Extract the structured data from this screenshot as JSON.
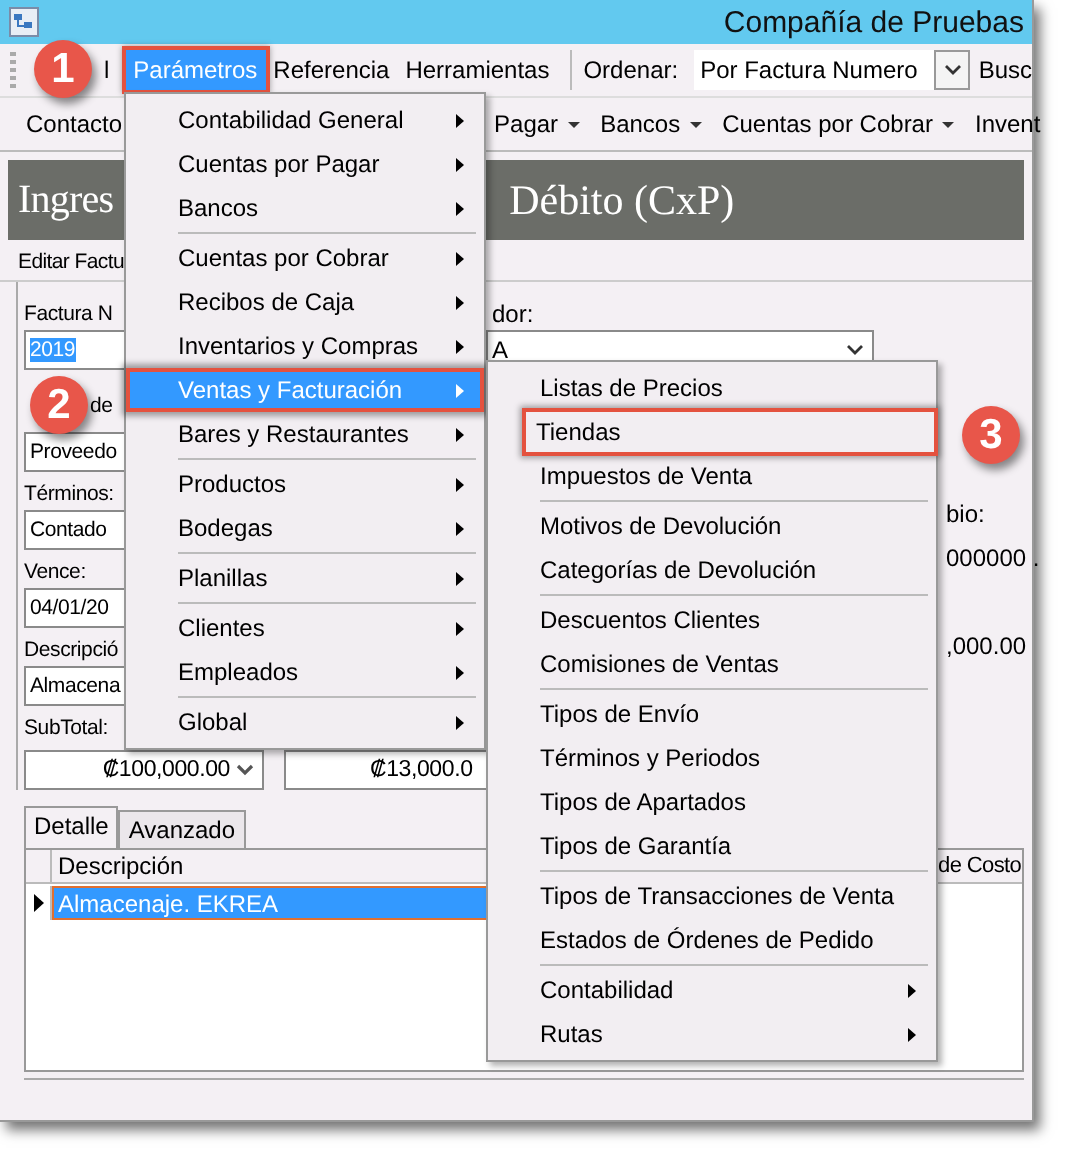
{
  "window": {
    "title": "Compañía de Pruebas"
  },
  "menu_bar": {
    "items": [
      {
        "label": "l",
        "selected": false,
        "highlighted": false
      },
      {
        "label": "Parámetros",
        "selected": true,
        "highlighted": true
      },
      {
        "label": "Referencia",
        "selected": false,
        "highlighted": false
      },
      {
        "label": "Herramientas",
        "selected": false,
        "highlighted": false
      }
    ],
    "sort_label": "Ordenar:",
    "sort_value": "Por Factura Numero",
    "search_label": "Busc"
  },
  "toolbar": {
    "items": [
      {
        "label": "Contacto",
        "dropdown": false
      },
      {
        "label": "Pagar",
        "dropdown": true
      },
      {
        "label": "Bancos",
        "dropdown": true
      },
      {
        "label": "Cuentas por Cobrar",
        "dropdown": true
      },
      {
        "label": "Invent",
        "dropdown": false
      }
    ]
  },
  "header": {
    "title_start": "Ingres",
    "title_end": "Débito (CxP)"
  },
  "subheader": "Editar Factu",
  "form": {
    "fields": [
      {
        "label": "Factura N",
        "value": "2019",
        "value_selected": true,
        "label_covered": false
      },
      {
        "label": "de",
        "value": "Proveedo",
        "value_selected": false,
        "label_covered": true
      },
      {
        "label": "Términos:",
        "value": "Contado",
        "value_selected": false,
        "label_covered": false
      },
      {
        "label": "Vence:",
        "value": "04/01/20",
        "value_selected": false,
        "label_covered": false
      },
      {
        "label": "Descripció",
        "value": "Almacena",
        "value_selected": false,
        "label_covered": false
      }
    ],
    "subtotal_label": "SubTotal:",
    "amounts": [
      {
        "value": "₡100,000.00",
        "spinner": true
      },
      {
        "value": "₡13,000.0",
        "spinner": false
      }
    ],
    "vendor_label": "dor:",
    "vendor_value": "A",
    "rate_label": "bio:",
    "rate_value": "000000 .",
    "total_value": ",000.00"
  },
  "tabs": [
    {
      "label": "Detalle",
      "selected": true
    },
    {
      "label": "Avanzado",
      "selected": false
    }
  ],
  "grid": {
    "columns": [
      "Descripción",
      "de Costo"
    ],
    "rows": [
      {
        "description": "Almacenaje. EKREA",
        "selected": true
      }
    ]
  },
  "menu": {
    "items": [
      {
        "kind": "item",
        "label": "Contabilidad General",
        "submenu": true,
        "selected": false,
        "highlighted": false
      },
      {
        "kind": "item",
        "label": "Cuentas por Pagar",
        "submenu": true,
        "selected": false,
        "highlighted": false
      },
      {
        "kind": "item",
        "label": "Bancos",
        "submenu": true,
        "selected": false,
        "highlighted": false
      },
      {
        "kind": "separator"
      },
      {
        "kind": "item",
        "label": "Cuentas por Cobrar",
        "submenu": true,
        "selected": false,
        "highlighted": false
      },
      {
        "kind": "item",
        "label": "Recibos de Caja",
        "submenu": true,
        "selected": false,
        "highlighted": false
      },
      {
        "kind": "item",
        "label": "Inventarios y Compras",
        "submenu": true,
        "selected": false,
        "highlighted": false
      },
      {
        "kind": "item",
        "label": "Ventas y Facturación",
        "submenu": true,
        "selected": true,
        "highlighted": true
      },
      {
        "kind": "item",
        "label": "Bares y Restaurantes",
        "submenu": true,
        "selected": false,
        "highlighted": false
      },
      {
        "kind": "separator"
      },
      {
        "kind": "item",
        "label": "Productos",
        "submenu": true,
        "selected": false,
        "highlighted": false
      },
      {
        "kind": "item",
        "label": "Bodegas",
        "submenu": true,
        "selected": false,
        "highlighted": false
      },
      {
        "kind": "separator"
      },
      {
        "kind": "item",
        "label": "Planillas",
        "submenu": true,
        "selected": false,
        "highlighted": false
      },
      {
        "kind": "separator"
      },
      {
        "kind": "item",
        "label": "Clientes",
        "submenu": true,
        "selected": false,
        "highlighted": false
      },
      {
        "kind": "item",
        "label": "Empleados",
        "submenu": true,
        "selected": false,
        "highlighted": false
      },
      {
        "kind": "separator"
      },
      {
        "kind": "item",
        "label": "Global",
        "submenu": true,
        "selected": false,
        "highlighted": false
      }
    ]
  },
  "submenu": {
    "items": [
      {
        "kind": "item",
        "label": "Listas de Precios",
        "submenu": false,
        "selected": false,
        "highlighted": false
      },
      {
        "kind": "item",
        "label": "Tiendas",
        "submenu": false,
        "selected": false,
        "highlighted": true
      },
      {
        "kind": "item",
        "label": "Impuestos de Venta",
        "submenu": false,
        "selected": false,
        "highlighted": false
      },
      {
        "kind": "separator"
      },
      {
        "kind": "item",
        "label": "Motivos de Devolución",
        "submenu": false,
        "selected": false,
        "highlighted": false
      },
      {
        "kind": "item",
        "label": "Categorías de Devolución",
        "submenu": false,
        "selected": false,
        "highlighted": false
      },
      {
        "kind": "separator"
      },
      {
        "kind": "item",
        "label": "Descuentos Clientes",
        "submenu": false,
        "selected": false,
        "highlighted": false
      },
      {
        "kind": "item",
        "label": "Comisiones de Ventas",
        "submenu": false,
        "selected": false,
        "highlighted": false
      },
      {
        "kind": "separator"
      },
      {
        "kind": "item",
        "label": "Tipos de Envío",
        "submenu": false,
        "selected": false,
        "highlighted": false
      },
      {
        "kind": "item",
        "label": "Términos y Periodos",
        "submenu": false,
        "selected": false,
        "highlighted": false
      },
      {
        "kind": "item",
        "label": "Tipos de Apartados",
        "submenu": false,
        "selected": false,
        "highlighted": false
      },
      {
        "kind": "item",
        "label": "Tipos de Garantía",
        "submenu": false,
        "selected": false,
        "highlighted": false
      },
      {
        "kind": "separator"
      },
      {
        "kind": "item",
        "label": "Tipos de Transacciones de Venta",
        "submenu": false,
        "selected": false,
        "highlighted": false
      },
      {
        "kind": "item",
        "label": "Estados de Órdenes de Pedido",
        "submenu": false,
        "selected": false,
        "highlighted": false
      },
      {
        "kind": "separator"
      },
      {
        "kind": "item",
        "label": "Contabilidad",
        "submenu": true,
        "selected": false,
        "highlighted": false
      },
      {
        "kind": "item",
        "label": "Rutas",
        "submenu": true,
        "selected": false,
        "highlighted": false
      }
    ]
  },
  "badges": [
    "1",
    "2",
    "3"
  ]
}
